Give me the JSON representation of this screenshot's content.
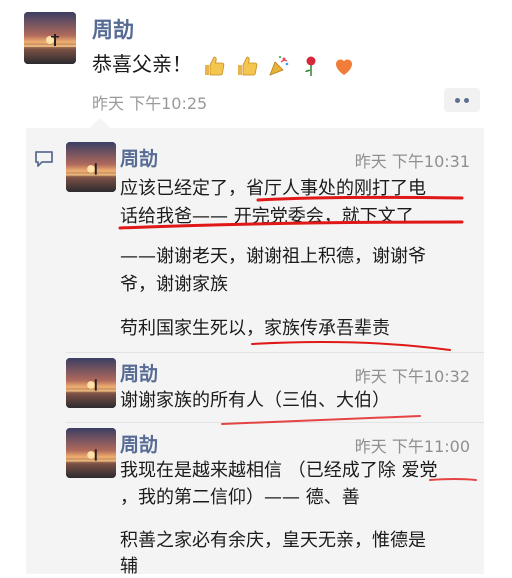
{
  "post": {
    "author": "周劼",
    "text": "恭喜父亲！",
    "emoji_icons": [
      "thumbs-up-icon",
      "thumbs-up-icon",
      "party-popper-icon",
      "rose-icon",
      "heart-icon"
    ],
    "time": "昨天 下午10:25"
  },
  "comments": [
    {
      "author": "周劼",
      "time": "昨天 下午10:31",
      "lines": [
        "应该已经定了，省厅人事处的刚打了电",
        "话给我爸—— 开完党委会，就下文了",
        "",
        "——谢谢老天，谢谢祖上积德，谢谢爷",
        "爷，谢谢家族",
        "",
        "苟利国家生死以，家族传承吾辈责"
      ]
    },
    {
      "author": "周劼",
      "time": "昨天 下午10:32",
      "lines": [
        "谢谢家族的所有人（三伯、大伯）"
      ]
    },
    {
      "author": "周劼",
      "time": "昨天 下午11:00",
      "lines": [
        "我现在是越来越相信 （已经成了除 爱党",
        "，我的第二信仰）—— 德、善",
        "",
        "积善之家必有余庆，皇天无亲，惟德是",
        "辅"
      ]
    }
  ],
  "colors": {
    "name": "#576b95",
    "time": "#9a9a9a",
    "comment_bg": "#f4f4f4",
    "underline": "#e01818"
  }
}
